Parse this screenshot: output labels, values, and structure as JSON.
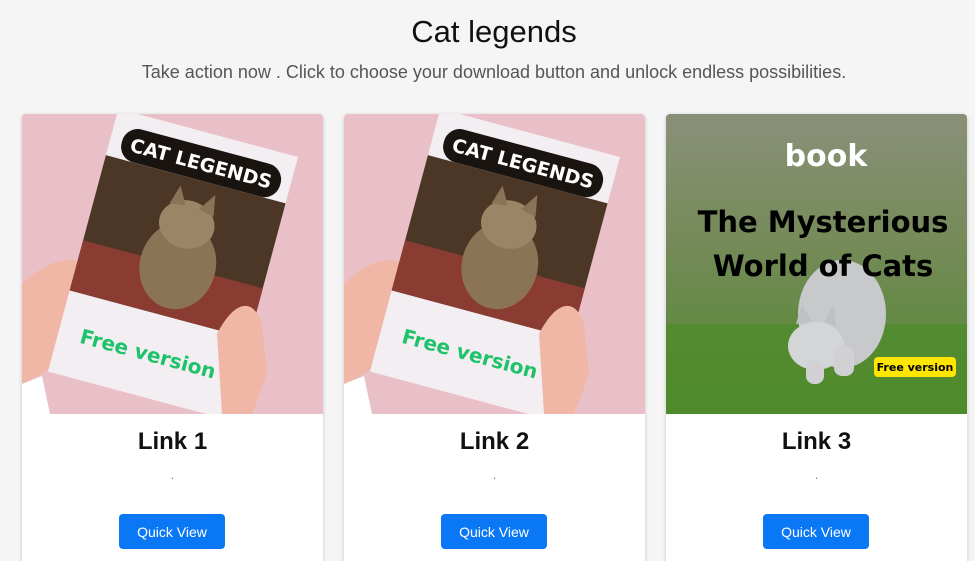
{
  "header": {
    "title": "Cat legends",
    "subtitle": "Take action now . Click to choose your download button and unlock endless possibilities."
  },
  "cards": [
    {
      "title": "Link 1",
      "dot": ".",
      "button_label": "Quick View",
      "cover": {
        "banner": "CAT LEGENDS",
        "badge": "Free version"
      }
    },
    {
      "title": "Link 2",
      "dot": ".",
      "button_label": "Quick View",
      "cover": {
        "banner": "CAT LEGENDS",
        "badge": "Free version"
      }
    },
    {
      "title": "Link 3",
      "dot": ".",
      "button_label": "Quick View",
      "cover": {
        "top": "book",
        "line1": "The Mysterious",
        "line2": "World of Cats",
        "badge": "Free version"
      }
    }
  ],
  "colors": {
    "accent": "#0a78f5",
    "free_green": "#1ec26a",
    "badge_yellow": "#ffe600",
    "pink_bg": "#e9c0c7"
  }
}
